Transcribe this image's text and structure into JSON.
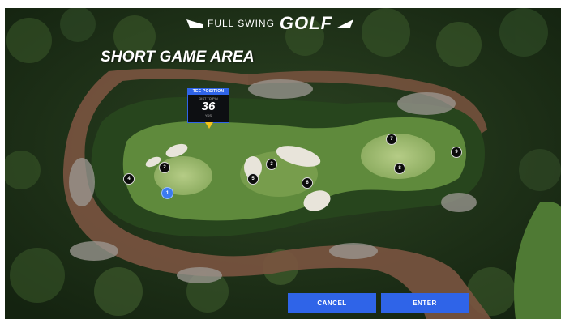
{
  "branding": {
    "full_swing": "FULL SWING",
    "golf": "GOLF"
  },
  "screen": {
    "title": "SHORT GAME AREA"
  },
  "tee_position": {
    "header": "TEE POSITION",
    "caption": "DIST TO PIN",
    "distance": "36",
    "unit": "YDS"
  },
  "pins": [
    {
      "id": "pin-1",
      "label": "1",
      "active": true
    },
    {
      "id": "pin-2",
      "label": "2",
      "active": false
    },
    {
      "id": "pin-3",
      "label": "3",
      "active": false
    },
    {
      "id": "pin-4",
      "label": "4",
      "active": false
    },
    {
      "id": "pin-5",
      "label": "5",
      "active": false
    },
    {
      "id": "pin-6",
      "label": "6",
      "active": false
    },
    {
      "id": "pin-7",
      "label": "7",
      "active": false
    },
    {
      "id": "pin-8",
      "label": "8",
      "active": false
    },
    {
      "id": "pin-9",
      "label": "9",
      "active": false
    }
  ],
  "actions": {
    "cancel": "CANCEL",
    "enter": "ENTER"
  },
  "colors": {
    "accent_blue": "#2f64e8",
    "marker_yellow": "#f4c21b",
    "green": "#8fae62",
    "rough": "#27451d",
    "path": "#7a5440"
  }
}
